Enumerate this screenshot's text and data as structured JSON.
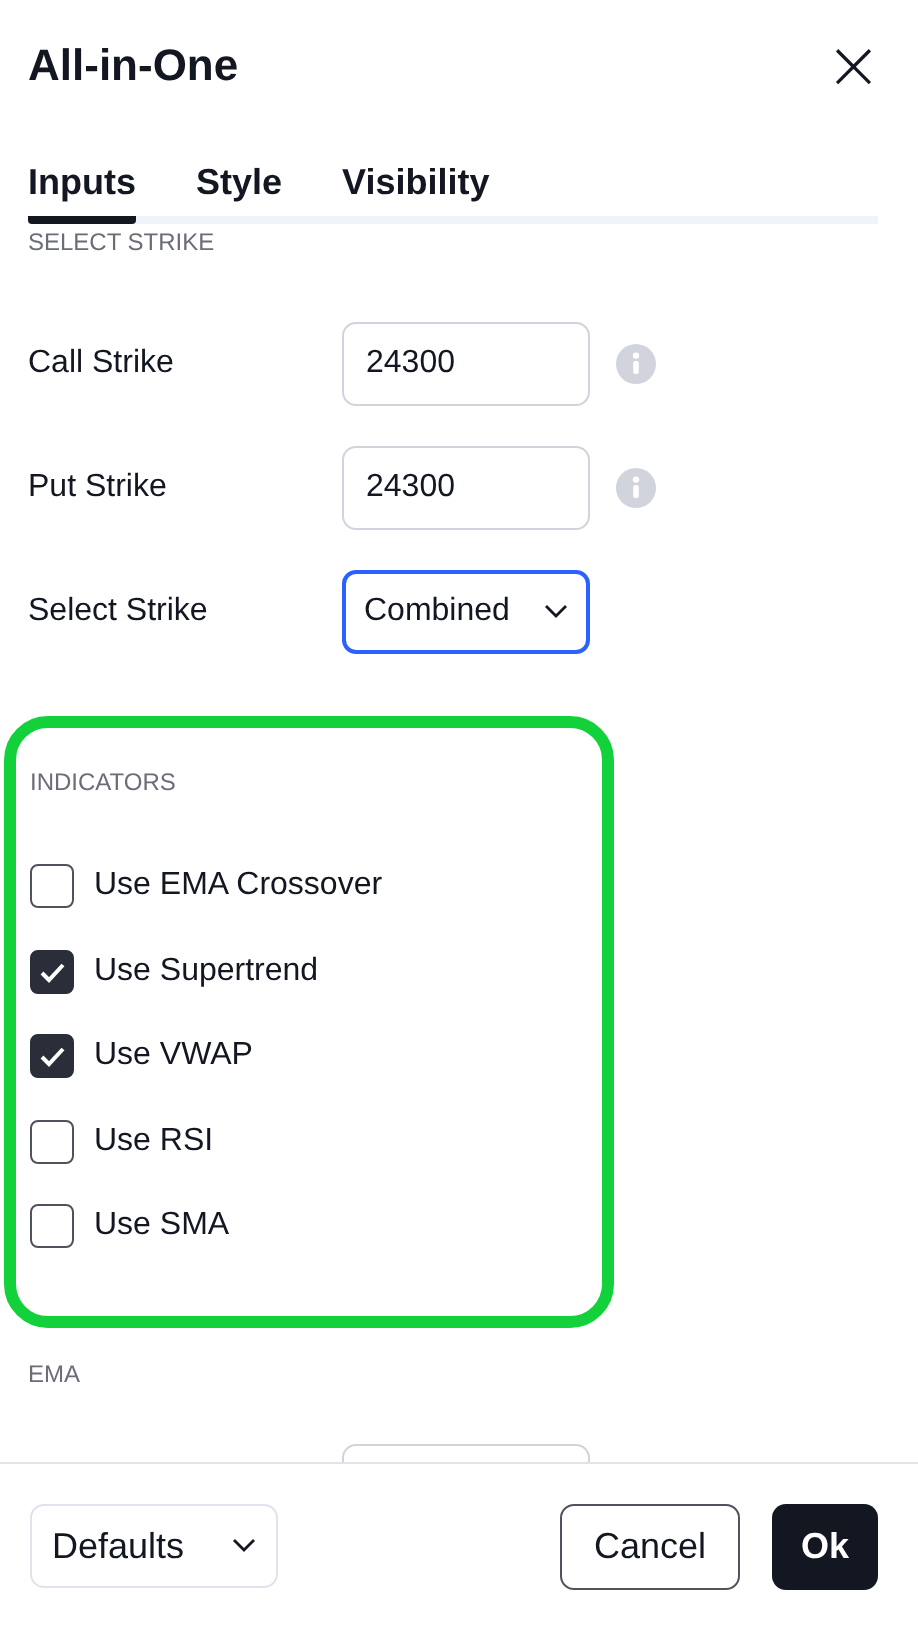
{
  "dialog": {
    "title": "All-in-One",
    "close": "×"
  },
  "tabs": [
    {
      "label": "Inputs",
      "selected": true
    },
    {
      "label": "Style",
      "selected": false
    },
    {
      "label": "Visibility",
      "selected": false
    }
  ],
  "sections": [
    {
      "heading": "SELECT STRIKE",
      "highlighted": false,
      "rows": [
        {
          "kind": "input",
          "label": "Call Strike",
          "value": "24300",
          "info": true
        },
        {
          "kind": "input",
          "label": "Put Strike",
          "value": "24300",
          "info": true
        },
        {
          "kind": "select",
          "label": "Select Strike",
          "value": "Combined",
          "focused": true
        }
      ]
    },
    {
      "heading": "INDICATORS",
      "highlighted": true,
      "rows": [
        {
          "kind": "checkbox",
          "label": "Use EMA Crossover",
          "checked": false
        },
        {
          "kind": "checkbox",
          "label": "Use Supertrend",
          "checked": true
        },
        {
          "kind": "checkbox",
          "label": "Use VWAP",
          "checked": true
        },
        {
          "kind": "checkbox",
          "label": "Use RSI",
          "checked": false
        },
        {
          "kind": "checkbox",
          "label": "Use SMA",
          "checked": false
        }
      ]
    },
    {
      "heading": "EMA",
      "highlighted": false,
      "rows": [
        {
          "kind": "partial"
        }
      ]
    }
  ],
  "footer": {
    "defaults": "Defaults",
    "cancel": "Cancel",
    "ok": "Ok"
  }
}
